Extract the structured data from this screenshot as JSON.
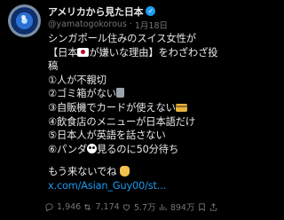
{
  "author": {
    "display_name": "アメリカから見た日本",
    "handle": "@yamatogokorous",
    "timestamp": "1月18日",
    "separator": "·"
  },
  "tweet": {
    "line1": "シンガポール住みのスイス女性が",
    "line2a": "【日本",
    "line2b": "が嫌いな理由】をわざわざ投",
    "line3": "稿",
    "items": [
      "①人が不親切",
      "②ゴミ箱がない",
      "③自販機でカードが使えない",
      "④飲食店のメニューが日本語だけ",
      "⑤日本人が英語を話さない",
      "⑥パンダ",
      "見るのに50分待ち"
    ],
    "closing": "もう来ないでね",
    "link_text": "x.com/Asian_Guy00/st..."
  },
  "actions": {
    "replies": "1,946",
    "reposts": "7,174",
    "likes": "5.7万",
    "views": "894万"
  },
  "colors": {
    "background": "#000000",
    "text": "#e7e9ea",
    "muted": "#71767b",
    "link": "#1d9bf0",
    "verified": "#1d9bf0"
  }
}
